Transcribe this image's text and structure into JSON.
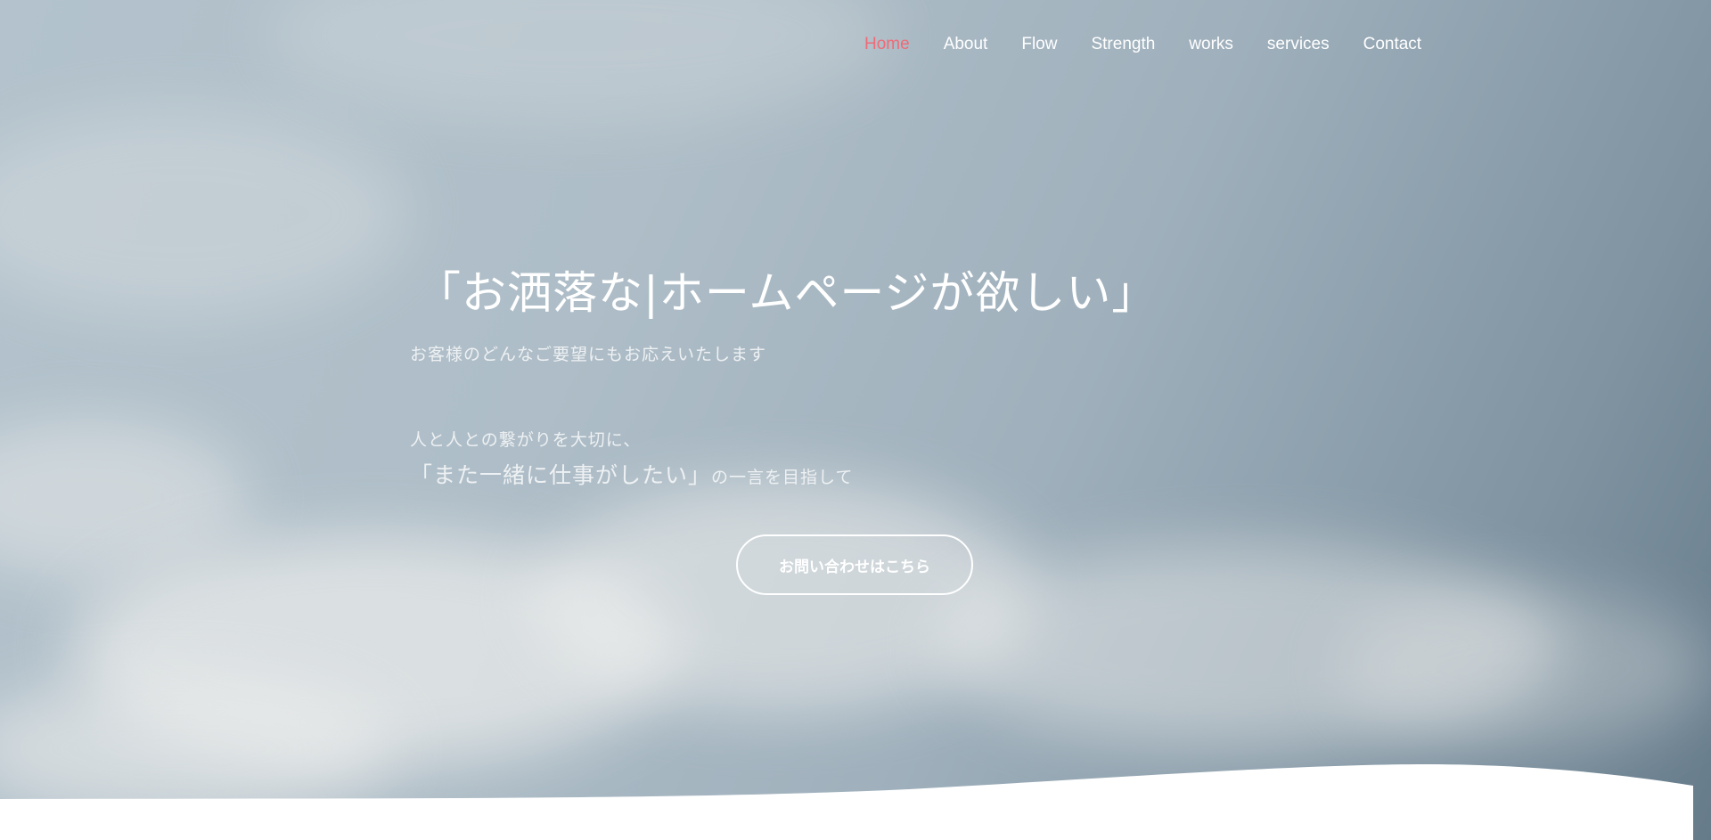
{
  "nav": {
    "items": [
      {
        "label": "Home",
        "active": true
      },
      {
        "label": "About"
      },
      {
        "label": "Flow"
      },
      {
        "label": "Strength"
      },
      {
        "label": "works"
      },
      {
        "label": "services"
      },
      {
        "label": "Contact"
      }
    ],
    "active_color": "#ee6b78"
  },
  "hero": {
    "headline": "「お洒落な|ホームページが欲しい」",
    "subheadline": "お客様のどんなご要望にもお応えいたします",
    "line1": "人と人との繋がりを大切に、",
    "line2_emphasis": "「また一緒に仕事がしたい」",
    "line2_rest": "の一言を目指して",
    "cta_label": "お問い合わせはこちら"
  }
}
